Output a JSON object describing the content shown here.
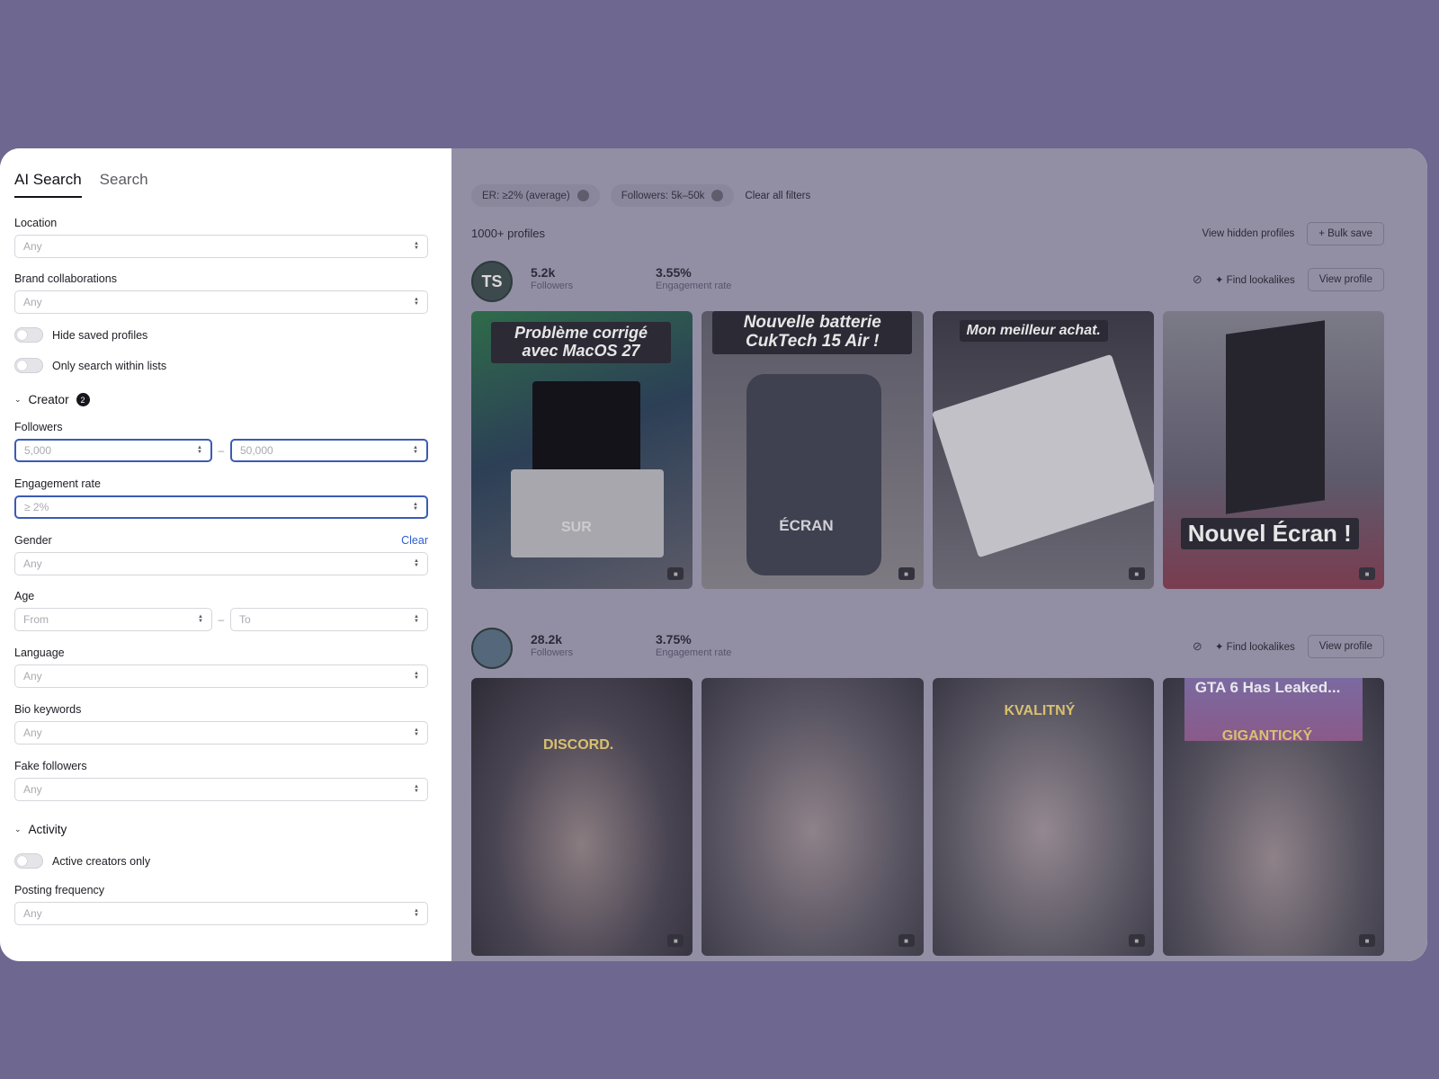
{
  "tabs": [
    "AI Search",
    "Search"
  ],
  "location": {
    "label": "Location",
    "value": "Any"
  },
  "brand": {
    "label": "Brand collaborations",
    "value": "Any"
  },
  "toggles": {
    "hide_saved": "Hide saved profiles",
    "only_lists": "Only search within lists",
    "active": "Active creators only"
  },
  "creator": {
    "title": "Creator",
    "badge": "2"
  },
  "followers": {
    "label": "Followers",
    "from": "5,000",
    "to": "50,000"
  },
  "engagement": {
    "label": "Engagement rate",
    "value": "≥ 2%"
  },
  "gender": {
    "label": "Gender",
    "clear": "Clear",
    "value": "Any"
  },
  "age": {
    "label": "Age",
    "from": "From",
    "to": "To"
  },
  "language": {
    "label": "Language",
    "value": "Any"
  },
  "bio": {
    "label": "Bio keywords",
    "value": "Any"
  },
  "fake": {
    "label": "Fake followers",
    "value": "Any"
  },
  "activity": {
    "title": "Activity"
  },
  "posting": {
    "label": "Posting frequency",
    "value": "Any"
  },
  "filters": {
    "chip1": "ER: ≥2% (average)",
    "chip2": "Followers: 5k–50k",
    "clear_all": "Clear all filters"
  },
  "results": {
    "count": "1000+ profiles",
    "view_hidden": "View hidden profiles",
    "bulk_save": "+ Bulk save"
  },
  "profiles": [
    {
      "initials": "TS",
      "followers": "5.2k",
      "followers_label": "Followers",
      "er": "3.55%",
      "er_label": "Engagement rate",
      "find": "Find lookalikes",
      "view": "View profile",
      "captions": [
        "Problème corrigé avec MacOS 27",
        "Nouvelle batterie CukTech 15 Air !",
        "Mon meilleur achat.",
        "Nouvel Écran !"
      ],
      "sub_captions": [
        "SUR",
        "ÉCRAN"
      ]
    },
    {
      "followers": "28.2k",
      "followers_label": "Followers",
      "er": "3.75%",
      "er_label": "Engagement rate",
      "find": "Find lookalikes",
      "view": "View profile",
      "captions": [
        "DISCORD.",
        "KVALITNÝ",
        "GTA 6 Has Leaked...",
        "GIGANTICKÝ"
      ]
    }
  ]
}
